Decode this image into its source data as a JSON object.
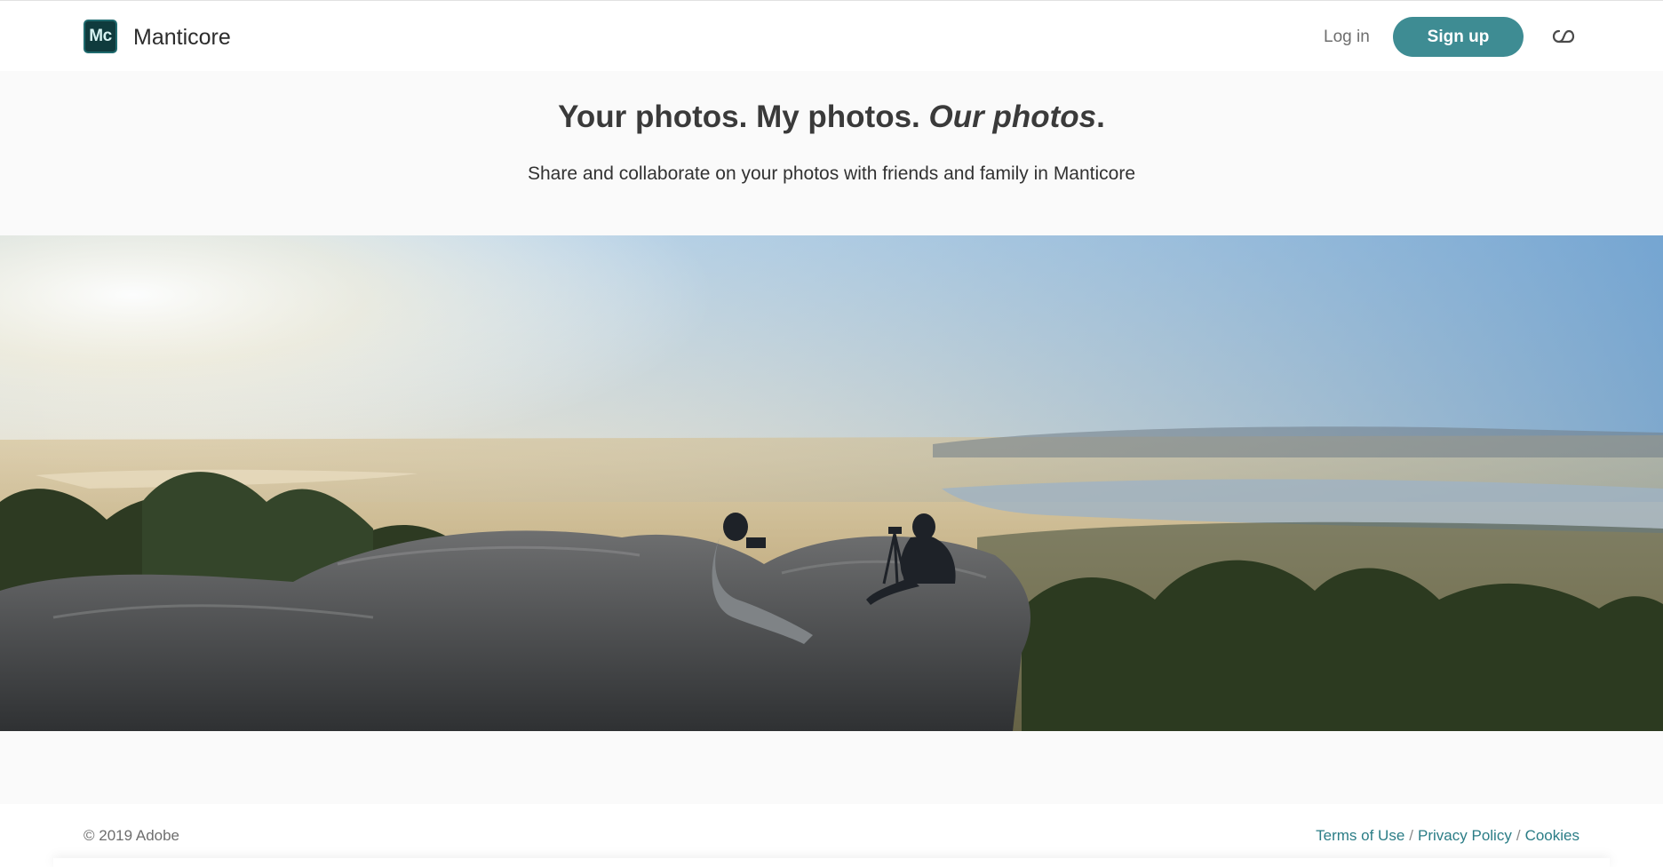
{
  "header": {
    "logo_text": "Mc",
    "brand_name": "Manticore",
    "login_label": "Log in",
    "signup_label": "Sign up",
    "cloud_icon": "creative-cloud-icon"
  },
  "hero": {
    "headline_part1": "Your photos. My photos.",
    "headline_emphasis": "Our photos",
    "headline_end": ".",
    "subheadline": "Share and collaborate on your photos with friends and family in Manticore"
  },
  "footer": {
    "copyright": "© 2019 Adobe",
    "links": [
      "Terms of Use",
      "Privacy Policy",
      "Cookies"
    ],
    "separator": "/"
  },
  "colors": {
    "accent": "#3e8c93",
    "link": "#2b7d86",
    "logo_bg": "#0f3b3d"
  }
}
